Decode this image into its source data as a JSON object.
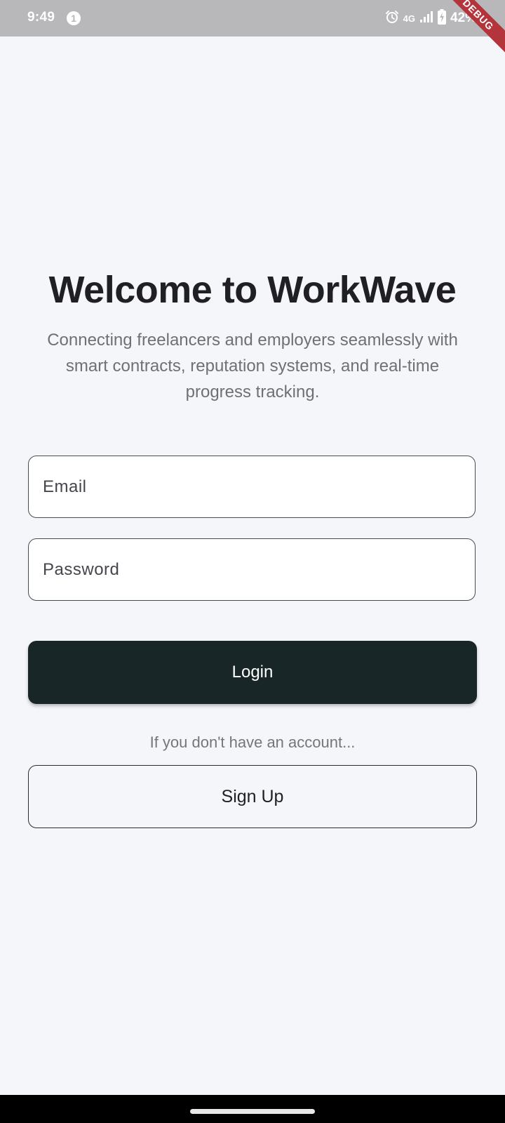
{
  "status_bar": {
    "time": "9:49",
    "notification_count": "1",
    "network_type": "4G",
    "battery_percent": "42%",
    "icons": [
      "alarm-icon",
      "signal-icon",
      "battery-charging-icon"
    ]
  },
  "debug_banner": "DEBUG",
  "login_screen": {
    "title": "Welcome to WorkWave",
    "subtitle": "Connecting freelancers and employers seamlessly with smart contracts, reputation systems, and real-time progress tracking.",
    "email_placeholder": "Email",
    "password_placeholder": "Password",
    "login_label": "Login",
    "account_hint": "If you don't have an account...",
    "signup_label": "Sign Up"
  },
  "colors": {
    "background": "#f5f6fa",
    "primary_button": "#192627",
    "status_bar": "#b8b8ba",
    "debug_ribbon": "#b4343c"
  }
}
